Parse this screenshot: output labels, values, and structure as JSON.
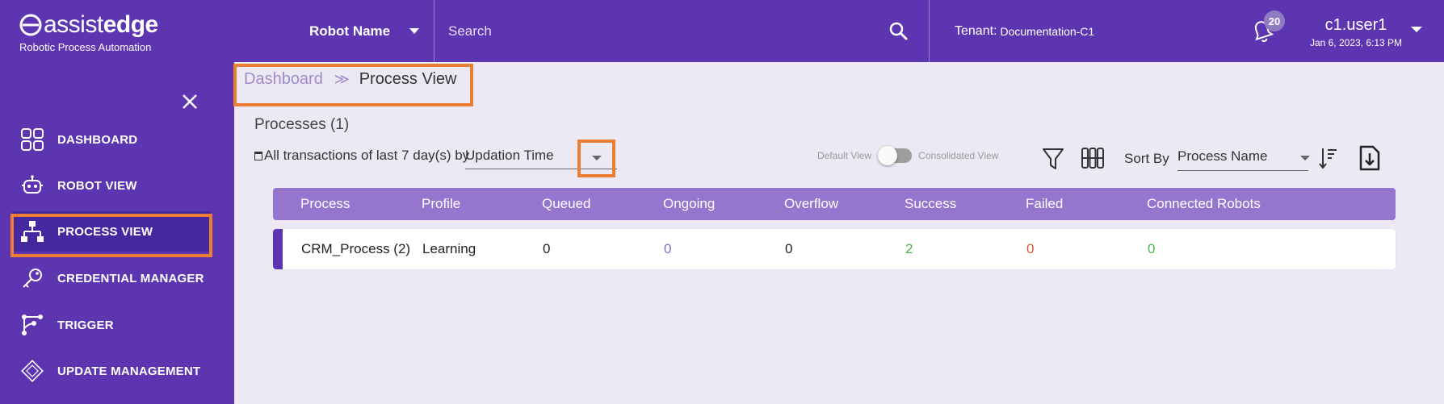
{
  "header": {
    "logo_light": "assist",
    "logo_bold": "edge",
    "tagline": "Robotic Process Automation",
    "robot_select_label": "Robot Name",
    "search_placeholder": "Search",
    "tenant_label": "Tenant:",
    "tenant_value": "Documentation-C1",
    "notification_count": "20",
    "user_name": "c1.user1",
    "user_datetime": "Jan 6, 2023, 6:13 PM"
  },
  "sidebar": {
    "items": [
      {
        "label": "DASHBOARD",
        "icon": "grid-icon"
      },
      {
        "label": "ROBOT VIEW",
        "icon": "robot-icon"
      },
      {
        "label": "PROCESS VIEW",
        "icon": "hierarchy-icon",
        "active": true
      },
      {
        "label": "CREDENTIAL MANAGER",
        "icon": "key-icon"
      },
      {
        "label": "TRIGGER",
        "icon": "trigger-icon"
      },
      {
        "label": "UPDATE MANAGEMENT",
        "icon": "chip-icon"
      }
    ]
  },
  "breadcrumb": {
    "parent": "Dashboard",
    "separator": "≫",
    "current": "Process View"
  },
  "main": {
    "title": "Processes (1)",
    "filter_text": "All transactions of last 7 day(s) by",
    "time_field": "Updation Time",
    "default_view_label": "Default View",
    "consolidated_view_label": "Consolidated View",
    "sort_by_label": "Sort By",
    "sort_field": "Process Name"
  },
  "table": {
    "columns": [
      "Process",
      "Profile",
      "Queued",
      "Ongoing",
      "Overflow",
      "Success",
      "Failed",
      "Connected Robots"
    ],
    "rows": [
      {
        "process": "CRM_Process (2)",
        "profile": "Learning",
        "queued": "0",
        "ongoing": "0",
        "overflow": "0",
        "success": "2",
        "failed": "0",
        "connected_robots": "0"
      }
    ]
  },
  "colors": {
    "primary": "#5e35b1",
    "table_header": "#9575cd",
    "highlight": "#ed7d31",
    "ongoing": "#7e6fc4",
    "success": "#4caf50",
    "failed": "#e0533a"
  }
}
